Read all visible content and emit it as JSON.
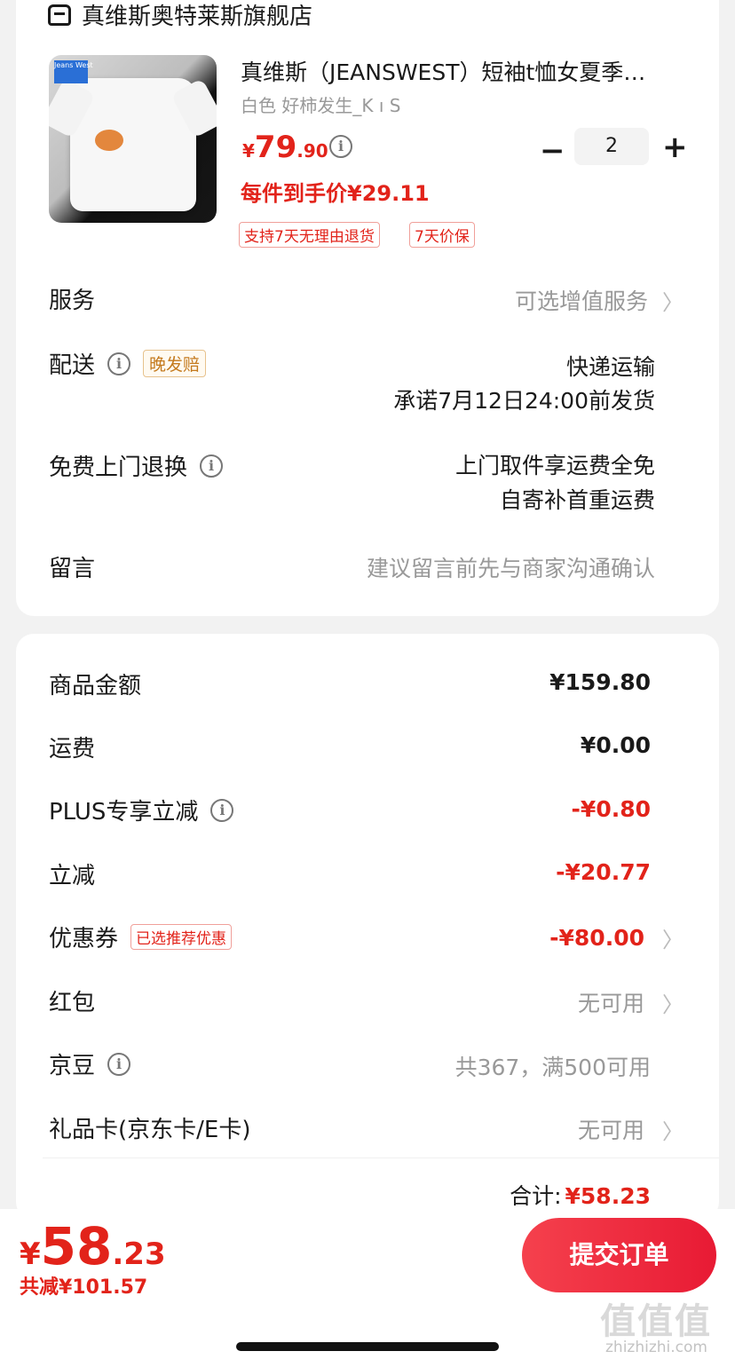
{
  "store": {
    "name": "真维斯奥特莱斯旗舰店"
  },
  "product": {
    "thumb_brand": "Jeans West",
    "title": "真维斯（JEANSWEST）短袖t恤女夏季…",
    "spec": "白色 好柿发生_K ı S",
    "price_currency": "¥",
    "price_int": "79",
    "price_dec": ".90",
    "unit_price_text": "每件到手价¥29.11",
    "quantity": "2",
    "minus_label": "−",
    "plus_label": "+",
    "tags": [
      "支持7天无理由退货",
      "7天价保"
    ]
  },
  "rows": {
    "service": {
      "label": "服务",
      "value": "可选增值服务"
    },
    "delivery": {
      "label": "配送",
      "tag": "晚发赔",
      "line1": "快递运输",
      "line2": "承诺7月12日24:00前发货"
    },
    "returns": {
      "label": "免费上门退换",
      "line1": "上门取件享运费全免",
      "line2": "自寄补首重运费"
    },
    "note": {
      "label": "留言",
      "placeholder": "建议留言前先与商家沟通确认"
    }
  },
  "summary": {
    "goods_amount": {
      "label": "商品金额",
      "value": "¥159.80"
    },
    "shipping": {
      "label": "运费",
      "value": "¥0.00"
    },
    "plus": {
      "label": "PLUS专享立减",
      "value": "-¥0.80"
    },
    "instant": {
      "label": "立减",
      "value": "-¥20.77"
    },
    "coupon": {
      "label": "优惠券",
      "tag": "已选推荐优惠",
      "value": "-¥80.00"
    },
    "redpacket": {
      "label": "红包",
      "value": "无可用"
    },
    "jingdou": {
      "label": "京豆",
      "value": "共367，满500可用"
    },
    "giftcard": {
      "label": "礼品卡(京东卡/E卡)",
      "value": "无可用"
    },
    "subtotal_label": "合计:",
    "subtotal_value": "¥58.23"
  },
  "bottom": {
    "currency": "¥",
    "total_int": "58",
    "total_dec": ".23",
    "saved": "共减¥101.57",
    "submit_label": "提交订单"
  },
  "watermark": {
    "text": "值值值",
    "url": "zhizhizhi.com"
  },
  "colors": {
    "accent": "#e2231a",
    "background": "#f2f2f2",
    "card": "#ffffff"
  }
}
